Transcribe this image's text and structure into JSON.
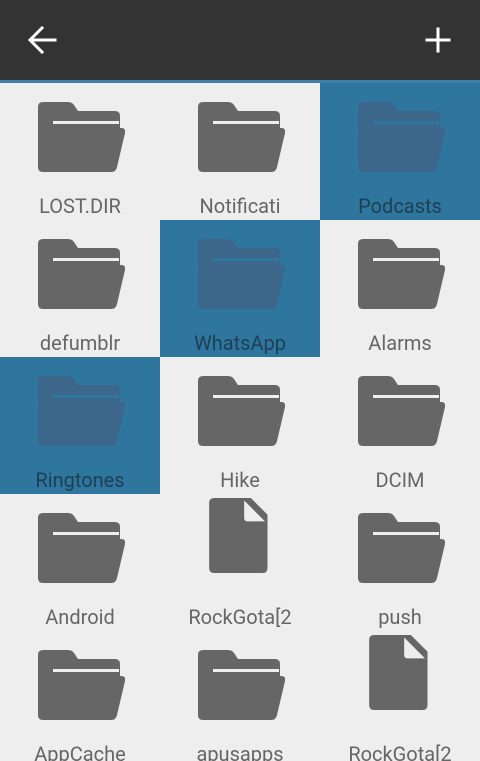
{
  "toolbar": {
    "back_icon": "arrow-left-icon",
    "add_icon": "plus-icon"
  },
  "colors": {
    "toolbar": "#333333",
    "accent": "#3d81ab",
    "selection": "#2f769f",
    "folder_icon": "#666666",
    "selected_folder_icon": "#3d678a",
    "background": "#eeeeee",
    "label": "#666666",
    "selected_label": "#1f3f52"
  },
  "items": [
    {
      "label": "LOST.DIR",
      "type": "folder",
      "selected": false
    },
    {
      "label": "Notificati",
      "type": "folder",
      "selected": false
    },
    {
      "label": "Podcasts",
      "type": "folder",
      "selected": true
    },
    {
      "label": "defumblr",
      "type": "folder",
      "selected": false
    },
    {
      "label": "WhatsApp",
      "type": "folder",
      "selected": true
    },
    {
      "label": "Alarms",
      "type": "folder",
      "selected": false
    },
    {
      "label": "Ringtones",
      "type": "folder",
      "selected": true
    },
    {
      "label": "Hike",
      "type": "folder",
      "selected": false
    },
    {
      "label": "DCIM",
      "type": "folder",
      "selected": false
    },
    {
      "label": "Android",
      "type": "folder",
      "selected": false
    },
    {
      "label": "RockGota[2",
      "type": "file",
      "selected": false
    },
    {
      "label": "push",
      "type": "folder",
      "selected": false
    },
    {
      "label": "AppCache",
      "type": "folder",
      "selected": false
    },
    {
      "label": "apusapps",
      "type": "folder",
      "selected": false
    },
    {
      "label": "RockGota[2",
      "type": "file",
      "selected": false
    }
  ]
}
